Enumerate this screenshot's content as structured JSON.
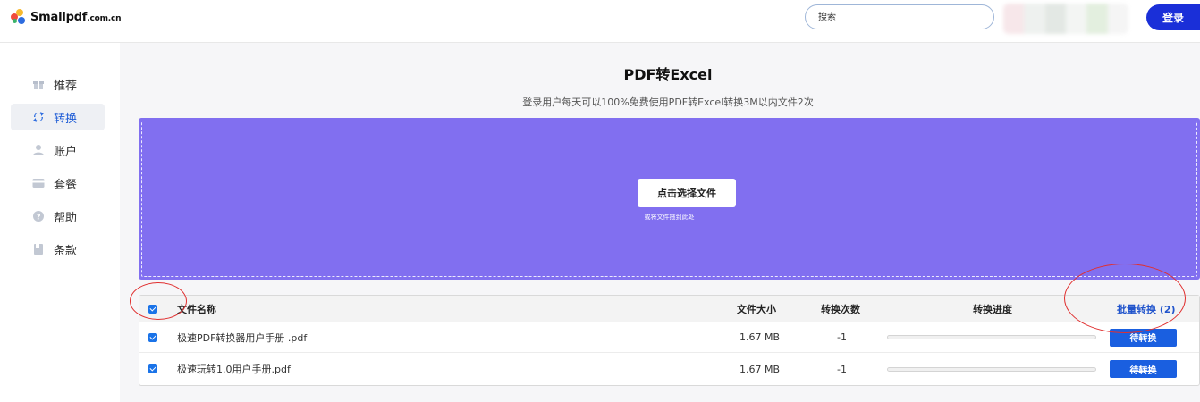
{
  "header": {
    "logo_text": "Smallpdf",
    "logo_suffix": ".com.cn",
    "search_placeholder": "搜索",
    "login_label": "登录"
  },
  "sidebar": {
    "items": [
      {
        "label": "推荐",
        "icon": "gift-icon"
      },
      {
        "label": "转换",
        "icon": "convert-icon",
        "active": true
      },
      {
        "label": "账户",
        "icon": "user-icon"
      },
      {
        "label": "套餐",
        "icon": "card-icon"
      },
      {
        "label": "帮助",
        "icon": "help-icon"
      },
      {
        "label": "条款",
        "icon": "document-icon"
      }
    ]
  },
  "main": {
    "title": "PDF转Excel",
    "subtitle": "登录用户每天可以100%免费使用PDF转Excel转换3M以内文件2次",
    "drop_zone": {
      "button_label": "点击选择文件",
      "hint": "或将文件拖到此处"
    },
    "table": {
      "headers": {
        "name": "文件名称",
        "size": "文件大小",
        "count": "转换次数",
        "progress": "转换进度",
        "batch": "批量转换 (2)"
      },
      "rows": [
        {
          "name": "极速PDF转换器用户手册 .pdf",
          "size": "1.67 MB",
          "count": "-1",
          "progress": 0,
          "status": "待转换"
        },
        {
          "name": "极速玩转1.0用户手册.pdf",
          "size": "1.67 MB",
          "count": "-1",
          "progress": 0,
          "status": "待转换"
        }
      ]
    }
  },
  "colors": {
    "accent": "#1a2fd8",
    "drop_zone": "#816ff0",
    "link": "#2255cc",
    "annotation": "#e03030"
  }
}
